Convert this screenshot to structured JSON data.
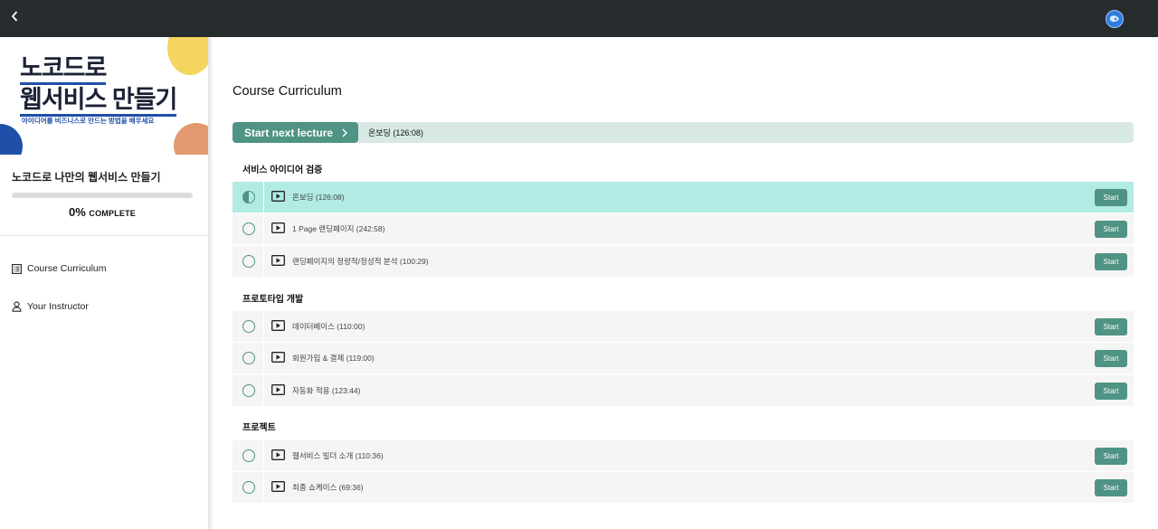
{
  "topbar": {
    "back_icon": "chevron-left-icon",
    "avatar_icon": "user-avatar-icon"
  },
  "banner": {
    "title_line1": "노코드로",
    "title_line2": "웹서비스 만들기",
    "subtitle": "아이디어를 비즈니스로 만드는 방법을 배우세요",
    "colors": {
      "yellow": "#f3d55f",
      "blue": "#1f4fa8",
      "orange": "#e4986f"
    }
  },
  "course": {
    "name": "노코드로 나만의 웹서비스 만들기",
    "progress_fraction": 0,
    "progress_percent": "0%",
    "progress_suffix": "COMPLETE"
  },
  "sidebar_nav": [
    {
      "label": "Course Curriculum",
      "icon": "list-icon"
    },
    {
      "label": "Your Instructor",
      "icon": "person-icon"
    }
  ],
  "main": {
    "title": "Course Curriculum",
    "next_button_label": "Start next lecture",
    "next_lecture_title": "온보딩 (126:08)"
  },
  "sections": [
    {
      "title": "서비스 아이디어 검증",
      "lectures": [
        {
          "title": "온보딩 (126:08)",
          "button": "Start",
          "status": "in-progress",
          "current": true
        },
        {
          "title": "1 Page 랜딩페이지 (242:58)",
          "button": "Start",
          "status": "not-started",
          "current": false
        },
        {
          "title": "랜딩페이지의 정량적/정성적 분석 (100:29)",
          "button": "Start",
          "status": "not-started",
          "current": false
        }
      ]
    },
    {
      "title": "프로토타입 개발",
      "lectures": [
        {
          "title": "데이터베이스 (110:00)",
          "button": "Start",
          "status": "not-started",
          "current": false
        },
        {
          "title": "회원가입 & 결제 (119:00)",
          "button": "Start",
          "status": "not-started",
          "current": false
        },
        {
          "title": "자동화 적용 (123:44)",
          "button": "Start",
          "status": "not-started",
          "current": false
        }
      ]
    },
    {
      "title": "프로젝트",
      "lectures": [
        {
          "title": "웹서비스 빌더 소개 (110:36)",
          "button": "Start",
          "status": "not-started",
          "current": false
        },
        {
          "title": "최종 쇼케이스 (69:36)",
          "button": "Start",
          "status": "not-started",
          "current": false
        }
      ]
    }
  ],
  "colors": {
    "accent": "#4f9384",
    "current_row": "#b1ebe3",
    "topbar": "#272c2e"
  }
}
